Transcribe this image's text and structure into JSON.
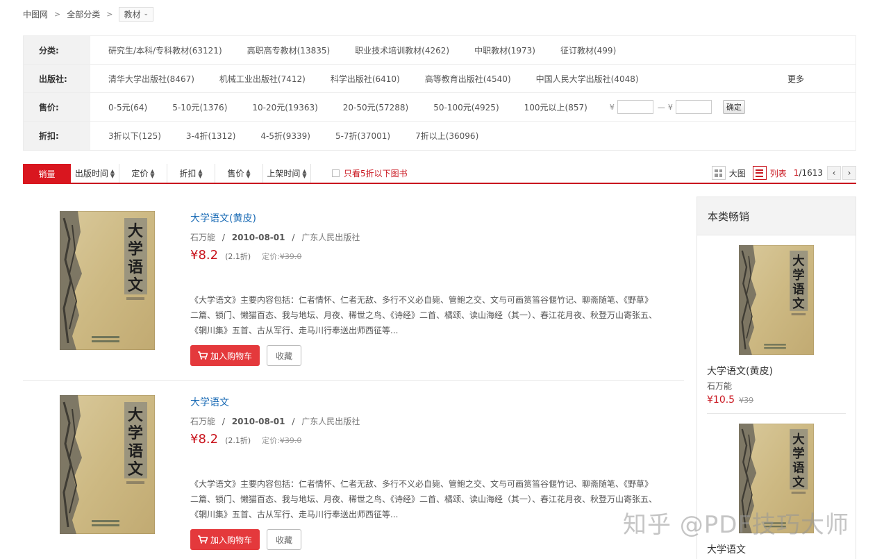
{
  "breadcrumb": {
    "home": "中图网",
    "all": "全部分类",
    "current": "教材"
  },
  "filters": {
    "category": {
      "label": "分类:",
      "items": [
        "研究生/本科/专科教材(63121)",
        "高职高专教材(13835)",
        "职业技术培训教材(4262)",
        "中职教材(1973)",
        "征订教材(499)"
      ]
    },
    "publisher": {
      "label": "出版社:",
      "items": [
        "清华大学出版社(8467)",
        "机械工业出版社(7412)",
        "科学出版社(6410)",
        "高等教育出版社(4540)",
        "中国人民大学出版社(4048)"
      ],
      "more": "更多"
    },
    "price": {
      "label": "售价:",
      "items": [
        "0-5元(64)",
        "5-10元(1376)",
        "10-20元(19363)",
        "20-50元(57288)",
        "50-100元(4925)",
        "100元以上(857)"
      ],
      "currency": "¥",
      "dash": "—",
      "min_value": "",
      "max_value": "",
      "confirm": "确定"
    },
    "discount": {
      "label": "折扣:",
      "items": [
        "3折以下(125)",
        "3-4折(1312)",
        "4-5折(9339)",
        "5-7折(37001)",
        "7折以上(36096)"
      ]
    }
  },
  "sort": {
    "sales": "销量",
    "pubdate": "出版时间",
    "list_price": "定价",
    "discount": "折扣",
    "price": "售价",
    "shelf_time": "上架时间",
    "only_five_off": "只看5折以下图书",
    "view_grid": "大图",
    "view_list": "列表",
    "page_current": "1",
    "page_total": "/1613"
  },
  "books": [
    {
      "title": "大学语文(黄皮)",
      "author": "石万能",
      "date": "2010-08-01",
      "publisher": "广东人民出版社",
      "price": "¥8.2",
      "discount": "(2.1折)",
      "orig_label": "定价:",
      "orig_price": "¥39.0",
      "desc": "《大学语文》主要内容包括：仁者情怀、仁者无敌、多行不义必自毙、管鲍之交、文与可画筼筜谷偃竹记、聊斋随笔、《野草》二篇、锁门、懒猫百态、我与地坛、月夜、稀世之鸟、《诗经》二首、橘颂、读山海经（其一）、春江花月夜、秋登万山寄张五、《辋川集》五首、古从军行、走马川行奉送出师西征等...",
      "cart": "加入购物车",
      "fav": "收藏"
    },
    {
      "title": "大学语文",
      "author": "石万能",
      "date": "2010-08-01",
      "publisher": "广东人民出版社",
      "price": "¥8.2",
      "discount": "(2.1折)",
      "orig_label": "定价:",
      "orig_price": "¥39.0",
      "desc": "《大学语文》主要内容包括：仁者情怀、仁者无敌、多行不义必自毙、管鲍之交、文与可画筼筜谷偃竹记、聊斋随笔、《野草》二篇、锁门、懒猫百态、我与地坛、月夜、稀世之鸟、《诗经》二首、橘颂、读山海经（其一）、春江花月夜、秋登万山寄张五、《辋川集》五首、古从军行、走马川行奉送出师西征等...",
      "cart": "加入购物车",
      "fav": "收藏"
    }
  ],
  "sidebar": {
    "title": "本类畅销",
    "books": [
      {
        "title": "大学语文(黄皮)",
        "author": "石万能",
        "price": "¥10.5",
        "orig": "¥39"
      },
      {
        "title": "大学语文"
      }
    ]
  },
  "watermark": "知乎 @PDF技巧大师",
  "colors": {
    "accent": "#c9151e",
    "link": "#1a6bb5",
    "cart": "#e4393c"
  }
}
